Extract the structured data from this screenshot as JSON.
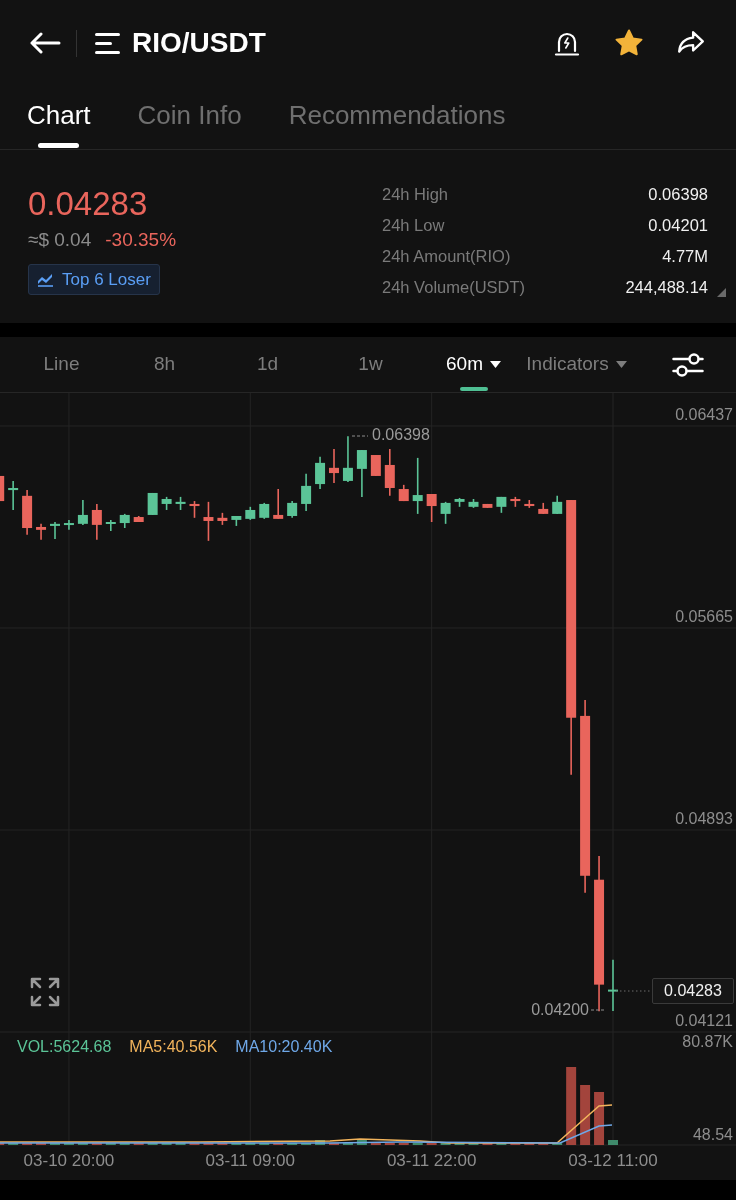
{
  "header": {
    "title": "RIO/USDT",
    "favorite": true
  },
  "tabs": [
    {
      "label": "Chart",
      "selected": true
    },
    {
      "label": "Coin Info",
      "selected": false
    },
    {
      "label": "Recommendations",
      "selected": false
    }
  ],
  "ticker": {
    "price": "0.04283",
    "fiat_price": "≈$ 0.04",
    "change": "-30.35%",
    "badge": "Top 6 Loser"
  },
  "stats": [
    {
      "label": "24h High",
      "value": "0.06398"
    },
    {
      "label": "24h Low",
      "value": "0.04201"
    },
    {
      "label": "24h Amount(RIO)",
      "value": "4.77M"
    },
    {
      "label": "24h Volume(USDT)",
      "value": "244,488.14"
    }
  ],
  "intervals": [
    {
      "label": "Line",
      "selected": false,
      "dropdown": false
    },
    {
      "label": "8h",
      "selected": false,
      "dropdown": false
    },
    {
      "label": "1d",
      "selected": false,
      "dropdown": false
    },
    {
      "label": "1w",
      "selected": false,
      "dropdown": false
    },
    {
      "label": "60m",
      "selected": true,
      "dropdown": true
    },
    {
      "label": "Indicators",
      "selected": false,
      "dropdown": true
    }
  ],
  "chart": {
    "chart_data": {
      "type": "candlestick",
      "categories": [
        null,
        null,
        null,
        null,
        null,
        "03-10 20:00",
        null,
        null,
        null,
        null,
        null,
        null,
        null,
        null,
        null,
        null,
        null,
        null,
        "03-11 09:00",
        null,
        null,
        null,
        null,
        null,
        null,
        null,
        null,
        null,
        null,
        null,
        null,
        "03-11 22:00",
        null,
        null,
        null,
        null,
        null,
        null,
        null,
        null,
        null,
        null,
        null,
        null,
        "03-12 11:00"
      ],
      "ohlc": [
        [
          0.06246,
          0.06254,
          0.0615,
          0.0615
        ],
        [
          0.06192,
          0.06227,
          0.06116,
          0.062
        ],
        [
          0.0617,
          0.06192,
          0.06021,
          0.06047
        ],
        [
          0.06051,
          0.06063,
          0.06002,
          0.0604
        ],
        [
          0.06055,
          0.0607,
          0.06005,
          0.06063
        ],
        [
          0.06059,
          0.06078,
          0.0604,
          0.06066
        ],
        [
          0.06063,
          0.06154,
          0.06059,
          0.06097
        ],
        [
          0.06116,
          0.06139,
          0.06002,
          0.06059
        ],
        [
          0.06063,
          0.06078,
          0.06036,
          0.0607
        ],
        [
          0.06066,
          0.06101,
          0.06047,
          0.06097
        ],
        [
          0.06089,
          0.06093,
          0.0607,
          0.0607
        ],
        [
          0.06097,
          0.06181,
          0.06097,
          0.06181
        ],
        [
          0.06139,
          0.06166,
          0.06116,
          0.06158
        ],
        [
          0.06139,
          0.06166,
          0.06116,
          0.06147
        ],
        [
          0.06139,
          0.0615,
          0.06086,
          0.06131
        ],
        [
          0.06089,
          0.06147,
          0.05998,
          0.06074
        ],
        [
          0.06086,
          0.06105,
          0.06059,
          0.06074
        ],
        [
          0.06078,
          0.06093,
          0.06055,
          0.06093
        ],
        [
          0.06082,
          0.06128,
          0.06078,
          0.06116
        ],
        [
          0.06086,
          0.06143,
          0.06082,
          0.06139
        ],
        [
          0.06097,
          0.06196,
          0.06082,
          0.06082
        ],
        [
          0.06093,
          0.0615,
          0.06086,
          0.06143
        ],
        [
          0.06139,
          0.06254,
          0.06112,
          0.06208
        ],
        [
          0.06215,
          0.06319,
          0.06196,
          0.06296
        ],
        [
          0.06277,
          0.06349,
          0.06219,
          0.06257
        ],
        [
          0.06227,
          0.06398,
          0.06223,
          0.06277
        ],
        [
          0.06273,
          0.06345,
          0.06166,
          0.06345
        ],
        [
          0.06326,
          0.06326,
          0.06246,
          0.06246
        ],
        [
          0.06288,
          0.06349,
          0.0617,
          0.062
        ],
        [
          0.06196,
          0.06212,
          0.0615,
          0.0615
        ],
        [
          0.0615,
          0.06315,
          0.06101,
          0.06173
        ],
        [
          0.06177,
          0.06177,
          0.0607,
          0.06131
        ],
        [
          0.06101,
          0.06147,
          0.06063,
          0.06143
        ],
        [
          0.06147,
          0.06162,
          0.06128,
          0.06158
        ],
        [
          0.06128,
          0.06158,
          0.06124,
          0.06147
        ],
        [
          0.06139,
          0.06139,
          0.06124,
          0.06124
        ],
        [
          0.06128,
          0.06166,
          0.06105,
          0.06166
        ],
        [
          0.06158,
          0.06166,
          0.06128,
          0.0615
        ],
        [
          0.06139,
          0.06154,
          0.06124,
          0.06131
        ],
        [
          0.0612,
          0.06143,
          0.06101,
          0.06101
        ],
        [
          0.06101,
          0.0617,
          0.06101,
          0.06147
        ],
        [
          0.06154,
          0.06154,
          0.05104,
          0.05322
        ],
        [
          0.05329,
          0.0539,
          0.04653,
          0.04718
        ],
        [
          0.04703,
          0.04794,
          0.042,
          0.04302
        ],
        [
          0.04278,
          0.04397,
          0.04201,
          0.04283
        ]
      ],
      "ylim": [
        0.04121,
        0.06563
      ],
      "yticks": [
        0.06437,
        0.05665,
        0.04893,
        0.04121
      ],
      "grid": true
    },
    "high_label": "0.06398",
    "low_label": "0.04200",
    "last_price": "0.04283",
    "volume_legend": [
      {
        "label": "VOL:5624.68",
        "color": "#5bc497"
      },
      {
        "label": "MA5:40.56K",
        "color": "#f2b45c"
      },
      {
        "label": "MA10:20.40K",
        "color": "#6fa8e8"
      }
    ],
    "volume_axis": [
      "80.87K",
      "48.54"
    ]
  }
}
